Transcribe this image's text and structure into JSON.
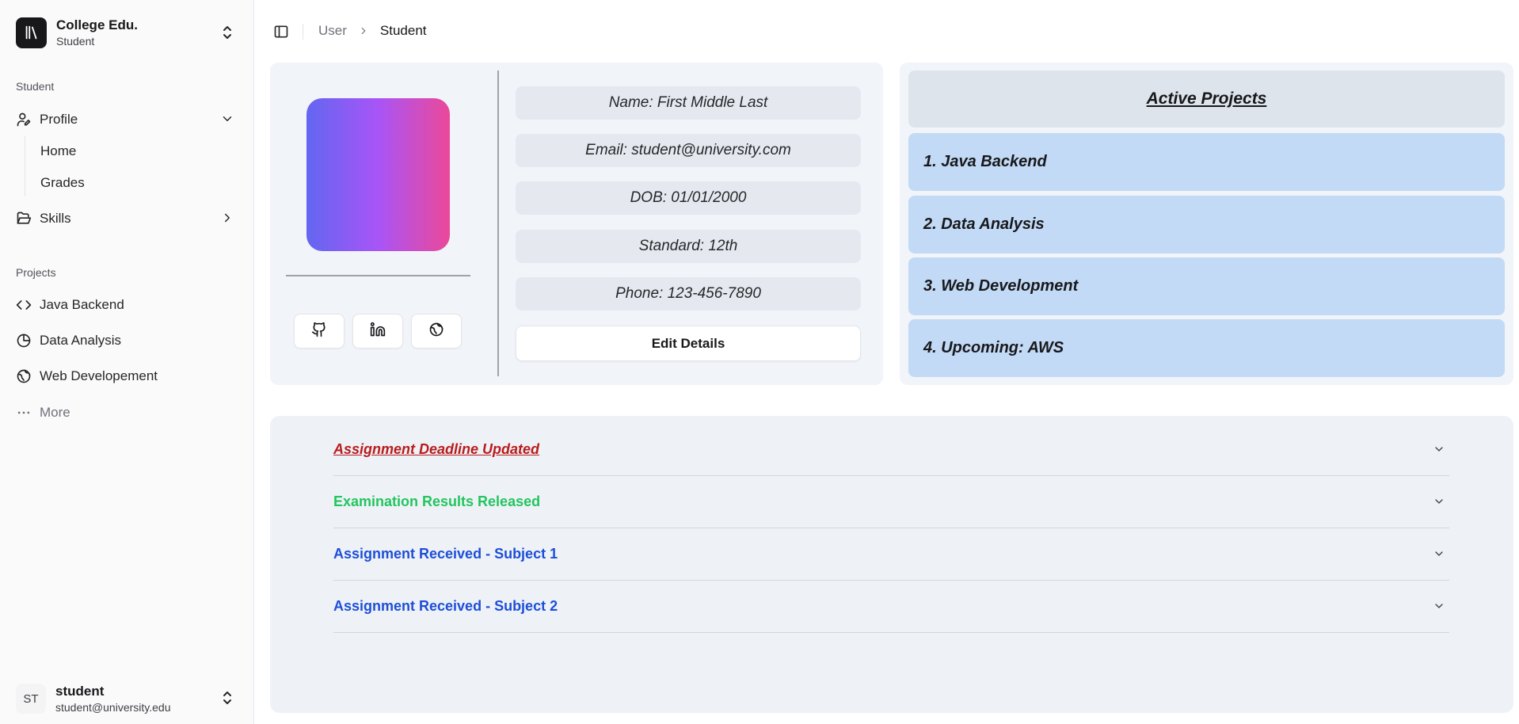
{
  "sidebar": {
    "team": {
      "name": "College Edu.",
      "plan": "Student"
    },
    "groups": {
      "student": "Student",
      "projects": "Projects"
    },
    "profile": {
      "label": "Profile",
      "sub": [
        "Home",
        "Grades"
      ]
    },
    "skills": {
      "label": "Skills"
    },
    "projects": [
      "Java Backend",
      "Data Analysis",
      "Web Developement"
    ],
    "more": "More",
    "user": {
      "initials": "ST",
      "name": "student",
      "email": "student@university.edu"
    }
  },
  "header": {
    "breadcrumb": [
      "User",
      "Student"
    ]
  },
  "profile_card": {
    "fields": [
      "Name: First Middle Last",
      "Email: student@university.com",
      "DOB: 01/01/2000",
      "Standard: 12th",
      "Phone: 123-456-7890"
    ],
    "edit_label": "Edit Details",
    "social_icons": [
      "github-icon",
      "linkedin-icon",
      "globe-icon"
    ],
    "avatar_gradient": [
      "#6366f1",
      "#a855f7",
      "#ec4899"
    ]
  },
  "projects_card": {
    "title": "Active Projects",
    "items": [
      "1. Java Backend",
      "2. Data Analysis",
      "3. Web Development",
      "4. Upcoming: AWS"
    ]
  },
  "notifications": [
    {
      "title": "Assignment Deadline Updated",
      "color": "#b91c1c"
    },
    {
      "title": "Examination Results Released",
      "color": "#22c55e"
    },
    {
      "title": "Assignment Received - Subject 1",
      "color": "#1d4ed8"
    },
    {
      "title": "Assignment Received - Subject 2",
      "color": "#1d4ed8"
    }
  ]
}
